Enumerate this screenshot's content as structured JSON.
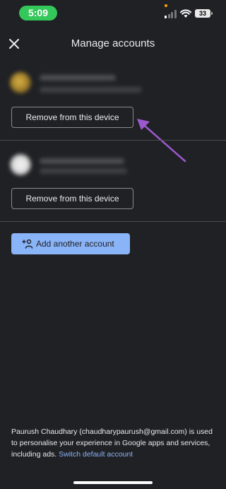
{
  "status_bar": {
    "time": "5:09",
    "battery": "33"
  },
  "header": {
    "title": "Manage accounts"
  },
  "accounts": [
    {
      "remove_label": "Remove from this device"
    },
    {
      "remove_label": "Remove from this device"
    }
  ],
  "add_account_label": "Add another account",
  "footer": {
    "text": "Paurush Chaudhary (chaudharypaurush@gmail.com) is used to personalise your experience in Google apps and services, including ads.",
    "link": "Switch default account"
  },
  "colors": {
    "background": "#202124",
    "accent": "#8ab4f8",
    "annotation_arrow": "#9b59d0"
  }
}
